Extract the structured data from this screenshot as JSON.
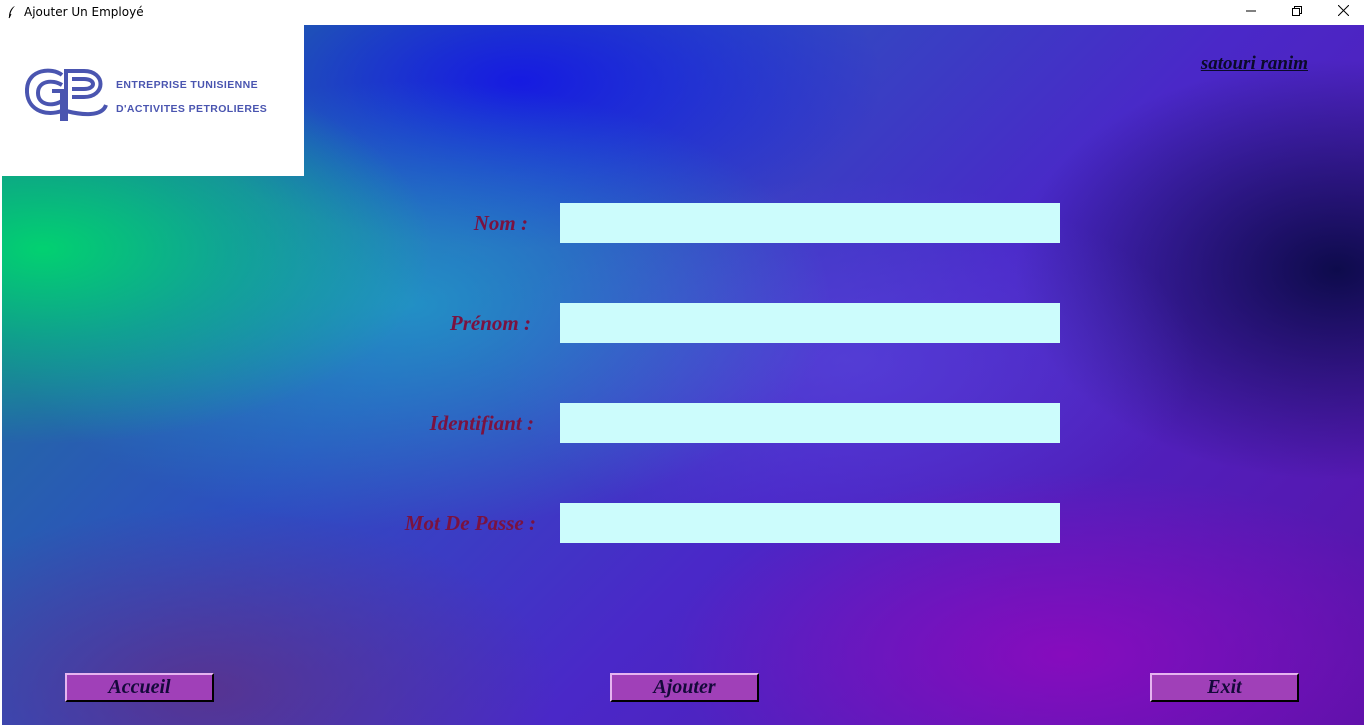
{
  "window": {
    "title": "Ajouter Un Employé",
    "controls": {
      "minimize_icon": "minimize-icon",
      "maximize_icon": "restore-icon",
      "close_icon": "close-icon"
    }
  },
  "logo": {
    "line1": "ENTREPRISE TUNISIENNE",
    "line2": "D'ACTIVITES PETROLIERES",
    "color": "#4a55b0"
  },
  "user": {
    "name": "satouri ranim"
  },
  "form": {
    "fields": [
      {
        "label": "Nom :",
        "value": ""
      },
      {
        "label": "Prénom :",
        "value": ""
      },
      {
        "label": "Identifiant :",
        "value": ""
      },
      {
        "label": "Mot De Passe :",
        "value": ""
      }
    ],
    "label_color": "#7a1240",
    "input_bg": "#ccfcfc"
  },
  "buttons": {
    "home": "Accueil",
    "add": "Ajouter",
    "exit": "Exit",
    "bg": "#a040b8"
  }
}
